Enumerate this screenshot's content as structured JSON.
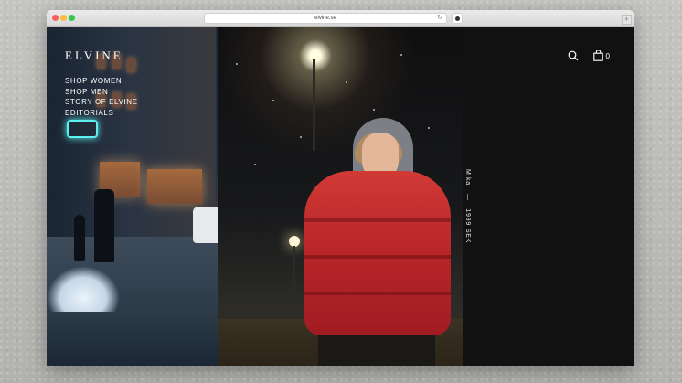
{
  "browser": {
    "url": "elvine.se",
    "reload_icon": "reload-icon",
    "new_tab_symbol": "+"
  },
  "site": {
    "logo": "ELVINE",
    "nav": [
      {
        "label": "SHOP WOMEN"
      },
      {
        "label": "SHOP MEN"
      },
      {
        "label": "STORY OF ELVINE"
      },
      {
        "label": "EDITORIALS"
      }
    ],
    "product": {
      "name": "Mika",
      "separator": "—",
      "price": "1999 SEK"
    },
    "cart_count": "0",
    "icons": [
      "search-icon",
      "bag-icon"
    ]
  },
  "colors": {
    "background_panel": "#111111",
    "jacket_red": "#c52f30",
    "text": "#ffffff"
  }
}
